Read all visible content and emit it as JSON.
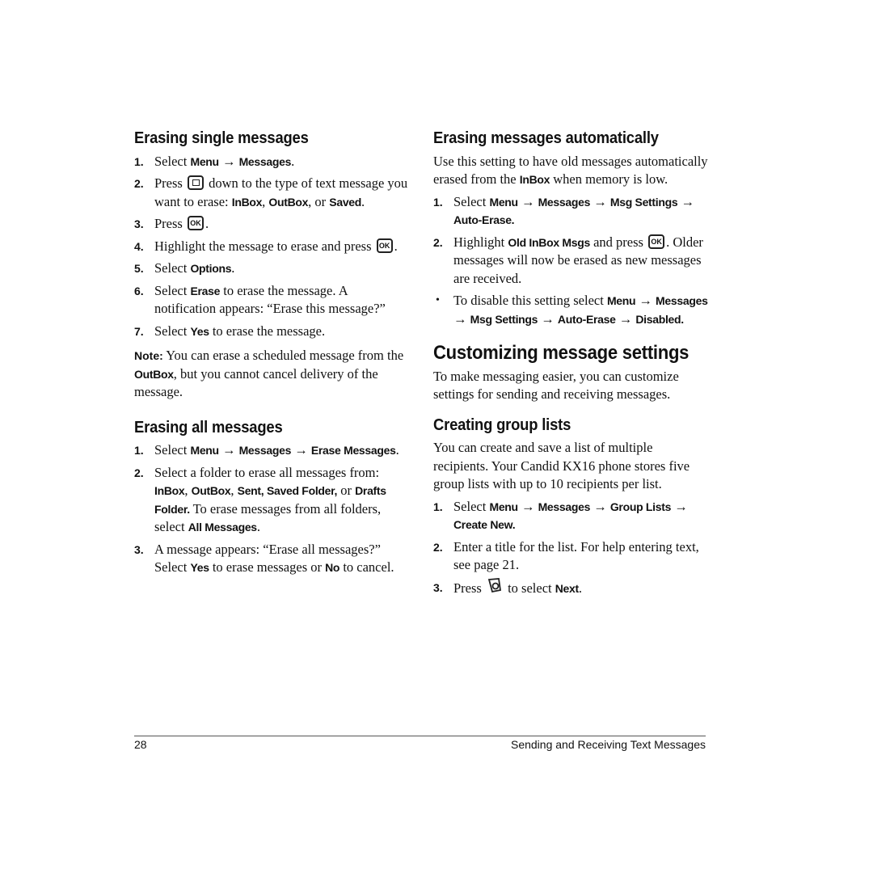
{
  "left": {
    "single": {
      "heading": "Erasing single messages",
      "steps": [
        {
          "num": "1.",
          "t1": "Select ",
          "b1": "Menu",
          "t2": " → ",
          "b2": "Messages",
          "t3": "."
        },
        {
          "num": "2.",
          "t1": "Press ",
          "icon": "nav-key",
          "t2": " down to the type of text message you want to erase: ",
          "b1": "InBox",
          "t3": ", ",
          "b2": "OutBox",
          "t4": ", or ",
          "b3": "Saved",
          "t5": "."
        },
        {
          "num": "3.",
          "t1": "Press ",
          "key": "OK",
          "t2": "."
        },
        {
          "num": "4.",
          "t1": "Highlight the message to erase and press ",
          "key": "OK",
          "t2": "."
        },
        {
          "num": "5.",
          "t1": "Select ",
          "b1": "Options",
          "t2": "."
        },
        {
          "num": "6.",
          "t1": "Select ",
          "b1": "Erase",
          "t2": " to erase the message. A notification appears: “Erase this message?”"
        },
        {
          "num": "7.",
          "t1": "Select ",
          "b1": "Yes",
          "t2": " to erase the message."
        }
      ],
      "note": {
        "label": "Note:",
        "t1": "  You can erase a scheduled message from the ",
        "b1": "OutBox",
        "t2": ", but you cannot cancel delivery of the message."
      }
    },
    "all": {
      "heading": "Erasing all messages",
      "steps": [
        {
          "num": "1.",
          "t1": "Select ",
          "b1": "Menu",
          "t2": " → ",
          "b2": "Messages",
          "t3": " → ",
          "b3": "Erase Messages",
          "t4": "."
        },
        {
          "num": "2.",
          "t1": "Select a folder to erase all messages from: ",
          "b1": "InBox",
          "t2": ", ",
          "b2": "OutBox",
          "t3": ", ",
          "b3": "Sent, Saved Folder,",
          "t4": " or ",
          "b4": "Drafts Folder.",
          "t5": " To erase messages from all folders, select ",
          "b5": "All Messages",
          "t6": "."
        },
        {
          "num": "3.",
          "t1": "A message appears: “Erase all messages?” Select ",
          "b1": "Yes",
          "t2": " to erase messages or ",
          "b2": "No",
          "t3": " to cancel."
        }
      ]
    }
  },
  "right": {
    "auto": {
      "heading": "Erasing messages automatically",
      "intro": {
        "t1": "Use this setting to have old messages automatically erased from the ",
        "b1": "InBox",
        "t2": " when memory is low."
      },
      "steps": [
        {
          "num": "1.",
          "t1": "Select ",
          "b1": "Menu",
          "t2": " → ",
          "b2": "Messages",
          "t3": " → ",
          "b3": "Msg Settings",
          "t4": " → ",
          "b4": "Auto-Erase."
        },
        {
          "num": "2.",
          "t1": "Highlight ",
          "b1": "Old InBox Msgs",
          "t2": " and press ",
          "key": "OK",
          "t3": ". Older messages will now be erased as new messages are received."
        }
      ],
      "bullet": {
        "t1": "To disable this setting select ",
        "b1": "Menu",
        "t2": " → ",
        "b2": "Messages",
        "t3": " → ",
        "b3": "Msg Settings",
        "t4": " → ",
        "b4": "Auto-Erase",
        "t5": " → ",
        "b5": "Disabled."
      }
    },
    "customize": {
      "heading": "Customizing message settings",
      "intro": "To make messaging easier, you can customize settings for sending and receiving messages."
    },
    "group": {
      "heading": "Creating group lists",
      "intro": "You can create and save a list of multiple recipients. Your Candid KX16 phone stores five group lists with up to 10 recipients per list.",
      "steps": [
        {
          "num": "1.",
          "t1": "Select ",
          "b1": "Menu",
          "t2": " → ",
          "b2": "Messages",
          "t3": " → ",
          "b3": "Group Lists",
          "t4": " → ",
          "b4": "Create New."
        },
        {
          "num": "2.",
          "t1": "Enter a title for the list. For help entering text, see page 21."
        },
        {
          "num": "3.",
          "t1": "Press ",
          "icon": "left-softkey",
          "t2": " to select ",
          "b1": "Next",
          "t3": "."
        }
      ]
    }
  },
  "footer": {
    "page_number": "28",
    "chapter_title": "Sending and Receiving Text Messages"
  }
}
